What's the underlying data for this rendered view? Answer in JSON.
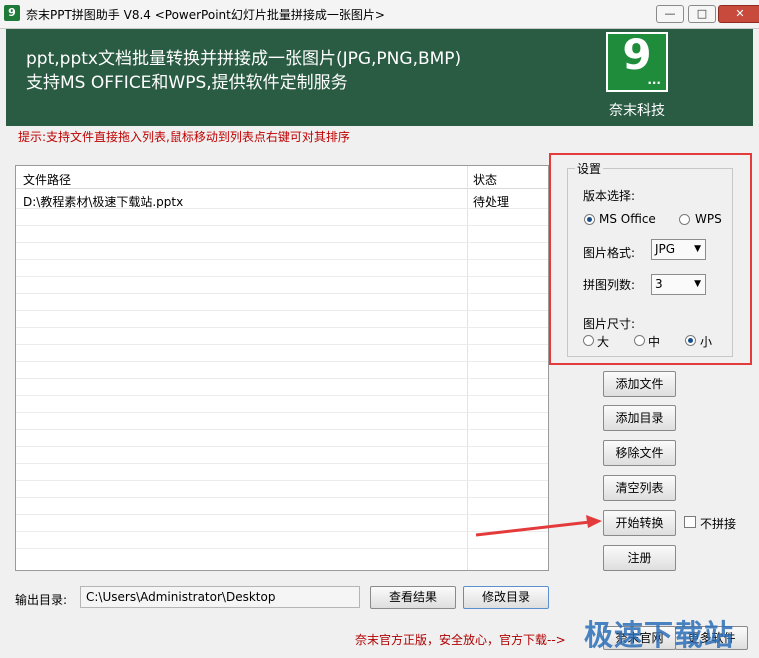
{
  "window": {
    "title": "奈末PPT拼图助手 V8.4 <PowerPoint幻灯片批量拼接成一张图片>",
    "icon_label": "9",
    "min_label": "—",
    "max_label": "□",
    "close_label": "✕"
  },
  "banner": {
    "line1": "ppt,pptx文档批量转换并拼接成一张图片(JPG,PNG,BMP)",
    "line2": "支持MS OFFICE和WPS,提供软件定制服务",
    "logo_digit": "9",
    "logo_dots": "...",
    "logo_caption": "奈末科技",
    "background": "#2a5b43"
  },
  "tip": "提示:支持文件直接拖入列表,鼠标移动到列表点右键可对其排序",
  "file_list": {
    "columns": [
      "文件路径",
      "状态"
    ],
    "rows": [
      {
        "path": "D:\\教程素材\\极速下载站.pptx",
        "status": "待处理"
      }
    ]
  },
  "settings": {
    "title": "设置",
    "version_label": "版本选择:",
    "version_options": [
      "MS Office",
      "WPS"
    ],
    "version_selected": "MS Office",
    "format_label": "图片格式:",
    "format_value": "JPG",
    "columns_label": "拼图列数:",
    "columns_value": "3",
    "size_label": "图片尺寸:",
    "size_options": [
      "大",
      "中",
      "小"
    ],
    "size_selected": "小"
  },
  "buttons": {
    "add_file": "添加文件",
    "add_dir": "添加目录",
    "remove_file": "移除文件",
    "clear_list": "清空列表",
    "start": "开始转换",
    "no_stitch": "不拼接",
    "register": "注册",
    "view_result": "查看结果",
    "change_dir": "修改目录",
    "bottom1": "奈末官网",
    "bottom2": "更多软件"
  },
  "output": {
    "label": "输出目录:",
    "path": "C:\\Users\\Administrator\\Desktop"
  },
  "footer": "奈末官方正版，安全放心，官方下载-->",
  "watermark": "极速下载站",
  "colors": {
    "accent_red": "#e33b3b",
    "tip_red": "#c00000",
    "logo_green": "#1e8c3a"
  }
}
